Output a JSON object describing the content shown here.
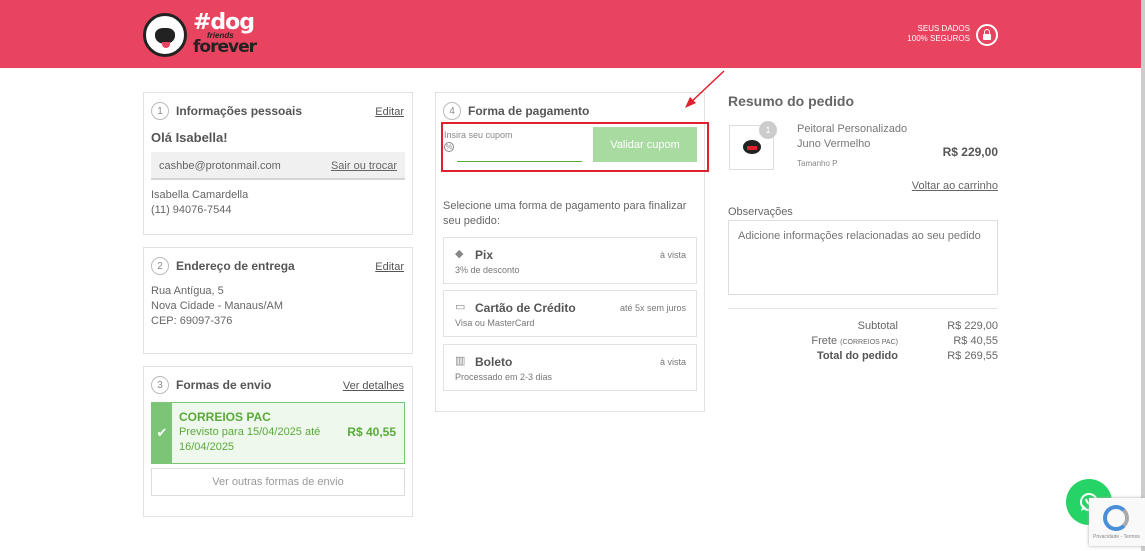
{
  "header": {
    "logo_hash": "#dog",
    "logo_friends": "friends",
    "logo_forever": "forever",
    "secure_line1": "SEUS DADOS",
    "secure_line2": "100% SEGUROS"
  },
  "personal": {
    "step": "1",
    "title": "Informações pessoais",
    "edit_label": "Editar",
    "greeting": "Olá Isabella!",
    "email": "cashbe@protonmail.com",
    "switch_label": "Sair ou trocar",
    "name": "Isabella Camardella",
    "phone": "(11) 94076-7544"
  },
  "address": {
    "step": "2",
    "title": "Endereço de entrega",
    "edit_label": "Editar",
    "line1": "Rua Antígua, 5",
    "line2": "Nova Cidade - Manaus/AM",
    "line3": "CEP: 69097-376"
  },
  "shipping": {
    "step": "3",
    "title": "Formas de envio",
    "details_label": "Ver detalhes",
    "option_name": "CORREIOS PAC",
    "option_eta": "Previsto para 15/04/2025 até 16/04/2025",
    "option_price": "R$ 40,55",
    "other_label": "Ver outras formas de envio"
  },
  "payment": {
    "step": "4",
    "title": "Forma de pagamento",
    "coupon_label": "Insira seu cupom",
    "coupon_value": "",
    "coupon_button": "Validar cupom",
    "intro": "Selecione uma forma de pagamento para finalizar seu pedido:",
    "options": [
      {
        "name": "Pix",
        "sub": "3% de desconto",
        "terms": "à vista",
        "icon": "pix-icon"
      },
      {
        "name": "Cartão de Crédito",
        "sub": "Visa ou MasterCard",
        "terms": "até 5x sem juros",
        "icon": "credit-card-icon"
      },
      {
        "name": "Boleto",
        "sub": "Processado em 2-3 dias",
        "terms": "à vista",
        "icon": "barcode-icon"
      }
    ]
  },
  "summary": {
    "title": "Resumo do pedido",
    "product_qty": "1",
    "product_name": "Peitoral Personalizado Juno Vermelho",
    "product_variant": "Tamanho P",
    "product_price": "R$ 229,00",
    "back_to_cart": "Voltar ao carrinho",
    "notes_label": "Observações",
    "notes_placeholder": "Adicione informações relacionadas ao seu pedido",
    "subtotal_label": "Subtotal",
    "subtotal_value": "R$ 229,00",
    "shipping_label": "Frete",
    "shipping_method": "(CORREIOS PAC)",
    "shipping_value": "R$ 40,55",
    "total_label": "Total do pedido",
    "total_value": "R$ 269,55"
  },
  "colors": {
    "brand": "#e8435f",
    "success": "#5aaa3a",
    "highlight": "#e0202e"
  },
  "widgets": {
    "recaptcha_text": "Privacidade - Termos"
  }
}
